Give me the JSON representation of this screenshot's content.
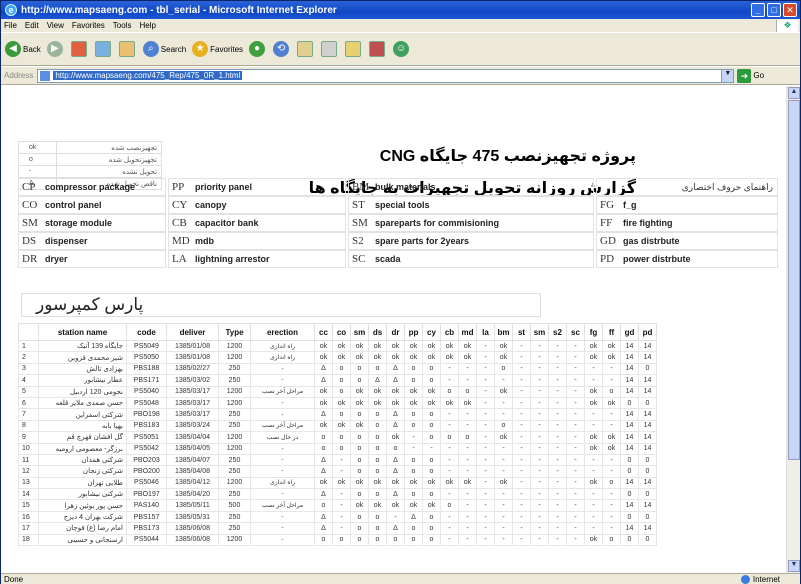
{
  "window": {
    "title": "http://www.mapsaeng.com - tbl_serial - Microsoft Internet Explorer",
    "icon": "ie-icon",
    "controls": [
      "minimize",
      "maximize",
      "close"
    ]
  },
  "menu": [
    "File",
    "Edit",
    "View",
    "Favorites",
    "Tools",
    "Help"
  ],
  "toolbar": {
    "back": "Back",
    "search": "Search",
    "favorites": "Favorites"
  },
  "address": {
    "label": "Address",
    "url": "http://www.mapsaeng.com/475_Rep/475_0R_1.html",
    "go": "Go"
  },
  "status": {
    "left": "Done",
    "zone": "Internet"
  },
  "legend_rows": [
    {
      "sym": "ok",
      "label": "تجهیزنصب شده"
    },
    {
      "sym": "o",
      "label": "تجهیزتحویل شده"
    },
    {
      "sym": "-",
      "label": "تحویل نشده"
    },
    {
      "sym": "Δ",
      "label": "ناقص تحویل شده"
    }
  ],
  "heading1": "پروژه تجهیزنصب 475 جایگاه CNG",
  "heading2": "گزارش روزانه تحویل تجهیزات به جایگاه ها",
  "abbr_title": "راهنمای حروف اختصاری",
  "abbreviations": [
    {
      "code": "CP",
      "name": "compressor package"
    },
    {
      "code": "CO",
      "name": "control panel"
    },
    {
      "code": "SM",
      "name": "storage module"
    },
    {
      "code": "DS",
      "name": "dispenser"
    },
    {
      "code": "DR",
      "name": "dryer"
    },
    {
      "code": "PP",
      "name": "priority panel"
    },
    {
      "code": "CY",
      "name": "canopy"
    },
    {
      "code": "CB",
      "name": "capacitor bank"
    },
    {
      "code": "MD",
      "name": "mdb"
    },
    {
      "code": "LA",
      "name": "lightning arrestor"
    },
    {
      "code": "BM",
      "name": "bulk materials"
    },
    {
      "code": "ST",
      "name": "special tools"
    },
    {
      "code": "SM",
      "name": "spareparts for commisioning"
    },
    {
      "code": "S2",
      "name": "spare parts for 2years"
    },
    {
      "code": "SC",
      "name": "scada"
    },
    {
      "code": "FG",
      "name": "f_g"
    },
    {
      "code": "FF",
      "name": "fire fighting"
    },
    {
      "code": "GD",
      "name": "gas distrbute"
    },
    {
      "code": "PD",
      "name": "power distrbute"
    }
  ],
  "company": "پارس کمپرسور",
  "table": {
    "headers": [
      "",
      "station name",
      "code",
      "deliver",
      "Type",
      "erection",
      "cc",
      "co",
      "sm",
      "ds",
      "dr",
      "pp",
      "cy",
      "cb",
      "md",
      "la",
      "bm",
      "st",
      "sm",
      "s2",
      "sc",
      "fg",
      "ff",
      "gd",
      "pd"
    ],
    "rows": [
      [
        "1",
        "جایگاه 139 آتیک",
        "PS5049",
        "1385/01/08",
        "1200",
        "راه اندازی",
        "ok",
        "ok",
        "ok",
        "ok",
        "ok",
        "ok",
        "ok",
        "ok",
        "ok",
        "-",
        "ok",
        "-",
        "-",
        "-",
        "-",
        "ok",
        "ok",
        "14",
        "14"
      ],
      [
        "2",
        "شیر محمدی قزوین",
        "PS5050",
        "1385/01/08",
        "1200",
        "راه اندازی",
        "ok",
        "ok",
        "ok",
        "ok",
        "ok",
        "ok",
        "ok",
        "ok",
        "ok",
        "-",
        "ok",
        "-",
        "-",
        "-",
        "-",
        "ok",
        "ok",
        "14",
        "14"
      ],
      [
        "3",
        "بهزادی تالش",
        "PBS188",
        "1385/02/27",
        "250",
        "-",
        "Δ",
        "o",
        "o",
        "o",
        "Δ",
        "o",
        "o",
        "-",
        "-",
        "-",
        "o",
        "-",
        "-",
        "-",
        "-",
        "-",
        "-",
        "14",
        "0"
      ],
      [
        "4",
        "عطار نیشابور",
        "PBS171",
        "1385/03/02",
        "250",
        "-",
        "Δ",
        "o",
        "o",
        "Δ",
        "Δ",
        "o",
        "o",
        "-",
        "-",
        "-",
        "-",
        "-",
        "-",
        "-",
        "-",
        "-",
        "-",
        "14",
        "14"
      ],
      [
        "5",
        "نجومی 120 اردبیل",
        "PS5040",
        "1385/03/17",
        "1200",
        "مراحل آخر نصب",
        "ok",
        "o",
        "ok",
        "ok",
        "ok",
        "ok",
        "ok",
        "o",
        "o",
        "-",
        "ok",
        "-",
        "-",
        "-",
        "-",
        "ok",
        "o",
        "14",
        "14"
      ],
      [
        "6",
        "حسن صمدی ملایر قلعه",
        "PS5048",
        "1385/03/17",
        "1200",
        "-",
        "ok",
        "ok",
        "ok",
        "ok",
        "ok",
        "ok",
        "ok",
        "ok",
        "ok",
        "-",
        "-",
        "-",
        "-",
        "-",
        "-",
        "ok",
        "ok",
        "0",
        "0"
      ],
      [
        "7",
        "شرکتی اسفراین",
        "PBO198",
        "1385/03/17",
        "250",
        "-",
        "Δ",
        "o",
        "o",
        "o",
        "Δ",
        "o",
        "o",
        "-",
        "-",
        "-",
        "-",
        "-",
        "-",
        "-",
        "-",
        "-",
        "-",
        "14",
        "14"
      ],
      [
        "8",
        "بهیا بابه",
        "PBS183",
        "1385/03/24",
        "250",
        "مراحل آخر نصب",
        "ok",
        "ok",
        "ok",
        "o",
        "Δ",
        "o",
        "o",
        "-",
        "-",
        "-",
        "o",
        "-",
        "-",
        "-",
        "-",
        "-",
        "-",
        "14",
        "14"
      ],
      [
        "9",
        "گل افشان قهرچ قم",
        "PS5051",
        "1385/04/04",
        "1200",
        "در حال نصب",
        "o",
        "o",
        "o",
        "o",
        "ok",
        "-",
        "o",
        "o",
        "o",
        "-",
        "ok",
        "-",
        "-",
        "-",
        "-",
        "ok",
        "ok",
        "14",
        "14"
      ],
      [
        "10",
        "برزگر- معصومی ارومیه",
        "PS5042",
        "1385/04/05",
        "1200",
        "-",
        "o",
        "o",
        "o",
        "o",
        "o",
        "-",
        "-",
        "-",
        "-",
        "-",
        "-",
        "-",
        "-",
        "-",
        "-",
        "ok",
        "ok",
        "14",
        "14"
      ],
      [
        "11",
        "شرکتی همدان",
        "PBO203",
        "1385/04/07",
        "250",
        "-",
        "Δ",
        "-",
        "o",
        "o",
        "Δ",
        "o",
        "o",
        "-",
        "-",
        "-",
        "-",
        "-",
        "-",
        "-",
        "-",
        "-",
        "-",
        "0",
        "0"
      ],
      [
        "12",
        "شرکتی زنجان",
        "PBO200",
        "1385/04/08",
        "250",
        "-",
        "Δ",
        "-",
        "o",
        "o",
        "Δ",
        "o",
        "o",
        "-",
        "-",
        "-",
        "-",
        "-",
        "-",
        "-",
        "-",
        "-",
        "-",
        "0",
        "0"
      ],
      [
        "13",
        "طلایی تهران",
        "PS5046",
        "1385/04/12",
        "1200",
        "راه اندازی",
        "ok",
        "ok",
        "ok",
        "ok",
        "ok",
        "ok",
        "ok",
        "ok",
        "ok",
        "-",
        "ok",
        "-",
        "-",
        "-",
        "-",
        "ok",
        "o",
        "14",
        "14"
      ],
      [
        "14",
        "شرکتی نیشابور",
        "PBO197",
        "1385/04/20",
        "250",
        "-",
        "Δ",
        "-",
        "o",
        "o",
        "Δ",
        "o",
        "o",
        "-",
        "-",
        "-",
        "-",
        "-",
        "-",
        "-",
        "-",
        "-",
        "-",
        "0",
        "0"
      ],
      [
        "15",
        "حسن پور بوئین زهرا",
        "PAS140",
        "1385/05/11",
        "500",
        "مراحل آخر نصب",
        "o",
        "-",
        "ok",
        "ok",
        "ok",
        "ok",
        "ok",
        "o",
        "-",
        "-",
        "-",
        "-",
        "-",
        "-",
        "-",
        "-",
        "-",
        "14",
        "14"
      ],
      [
        "16",
        "شرکت بهران 4 دیزج",
        "PBS157",
        "1385/05/31",
        "250",
        "-",
        "Δ",
        "-",
        "o",
        "o",
        "-",
        "Δ",
        "o",
        "-",
        "-",
        "-",
        "-",
        "-",
        "-",
        "-",
        "-",
        "-",
        "-",
        "0",
        "0"
      ],
      [
        "17",
        "امام رضا (ع) قوچان",
        "PBS173",
        "1385/06/08",
        "250",
        "-",
        "Δ",
        "-",
        "o",
        "o",
        "Δ",
        "o",
        "o",
        "-",
        "-",
        "-",
        "-",
        "-",
        "-",
        "-",
        "-",
        "-",
        "-",
        "14",
        "14"
      ],
      [
        "18",
        "ارسنجانی و حسینی",
        "PS5044",
        "1385/06/08",
        "1200",
        "-",
        "o",
        "o",
        "o",
        "o",
        "o",
        "o",
        "o",
        "-",
        "-",
        "-",
        "-",
        "-",
        "-",
        "-",
        "-",
        "ok",
        "o",
        "0",
        "0"
      ]
    ]
  }
}
